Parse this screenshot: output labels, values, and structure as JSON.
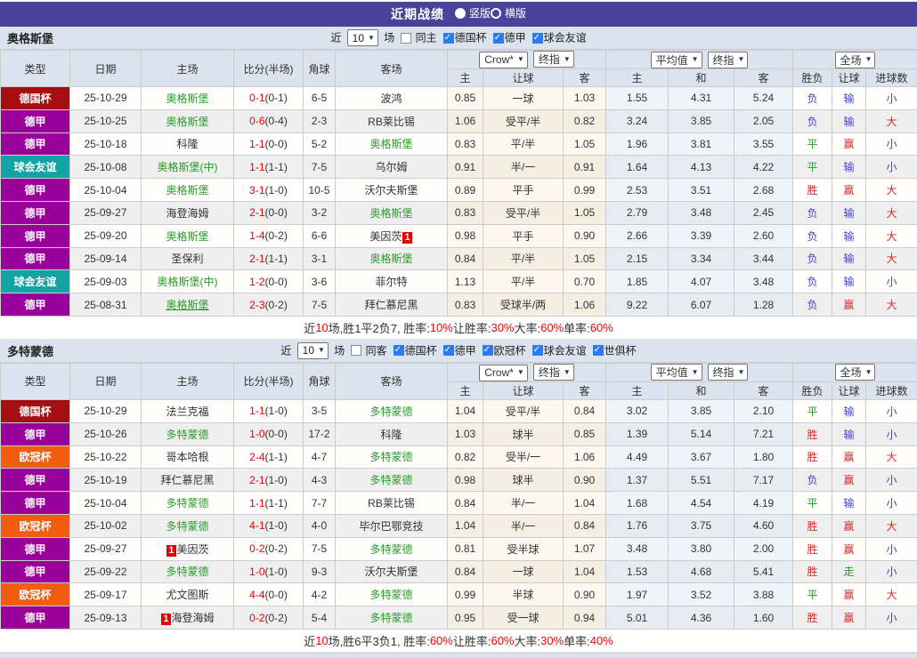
{
  "titlebar": {
    "title": "近期战绩",
    "radios": [
      {
        "label": "竖版",
        "selected": true
      },
      {
        "label": "横版",
        "selected": false
      }
    ]
  },
  "table_header": {
    "main_cols": [
      "类型",
      "日期",
      "主场",
      "比分(半场)",
      "角球",
      "客场"
    ],
    "groups": [
      {
        "selects": [
          "Crow*",
          "终指"
        ],
        "subs": [
          "主",
          "让球",
          "客"
        ]
      },
      {
        "selects": [
          "平均值",
          "终指"
        ],
        "subs": [
          "主",
          "和",
          "客"
        ]
      },
      {
        "selects": [
          "全场"
        ],
        "subs": [
          "胜负",
          "让球",
          "进球数"
        ]
      }
    ]
  },
  "type_colors": {
    "德国杯": "#a50e13",
    "德甲": "#990099",
    "球会友谊": "#13a3a3",
    "欧冠杯": "#f25c0f"
  },
  "colors": {
    "titlebar_bg": "#4b439b",
    "header_bg": "#dbe3ee",
    "team_green": "#2b9b2b",
    "score_red": "#e80000",
    "result_red": "#cf2d2d",
    "result_blue": "#4141cc",
    "result_green": "#2a9b2a",
    "summary_red": "#ff0000"
  },
  "sections": [
    {
      "team": "奥格斯堡",
      "filter": {
        "prefix": "近",
        "count": "10",
        "suffix": "场",
        "same": {
          "label": "同主",
          "checked": false
        },
        "leagues": [
          {
            "label": "德国杯",
            "checked": true
          },
          {
            "label": "德甲",
            "checked": true
          },
          {
            "label": "球会友谊",
            "checked": true
          }
        ]
      },
      "rows": [
        {
          "type": "德国杯",
          "date": "25-10-29",
          "home": {
            "name": "奥格斯堡",
            "green": true
          },
          "score": "0-1",
          "half": "(0-1)",
          "corner": "6-5",
          "away": {
            "name": "波鸿"
          },
          "odds": [
            "0.85",
            "一球",
            "1.03"
          ],
          "avg": [
            "1.55",
            "4.31",
            "5.24"
          ],
          "results": [
            [
              "负",
              "blue"
            ],
            [
              "输",
              "blue"
            ],
            [
              "小",
              "blue"
            ]
          ]
        },
        {
          "type": "德甲",
          "date": "25-10-25",
          "home": {
            "name": "奥格斯堡",
            "green": true
          },
          "score": "0-6",
          "half": "(0-4)",
          "corner": "2-3",
          "away": {
            "name": "RB莱比锡"
          },
          "odds": [
            "1.06",
            "受平/半",
            "0.82"
          ],
          "avg": [
            "3.24",
            "3.85",
            "2.05"
          ],
          "results": [
            [
              "负",
              "blue"
            ],
            [
              "输",
              "blue"
            ],
            [
              "大",
              "red"
            ]
          ]
        },
        {
          "type": "德甲",
          "date": "25-10-18",
          "home": {
            "name": "科隆"
          },
          "score": "1-1",
          "half": "(0-0)",
          "corner": "5-2",
          "away": {
            "name": "奥格斯堡",
            "green": true
          },
          "odds": [
            "0.83",
            "平/半",
            "1.05"
          ],
          "avg": [
            "1.96",
            "3.81",
            "3.55"
          ],
          "results": [
            [
              "平",
              "green"
            ],
            [
              "赢",
              "red"
            ],
            [
              "小",
              "blue"
            ]
          ]
        },
        {
          "type": "球会友谊",
          "date": "25-10-08",
          "home": {
            "name": "奥格斯堡(中)",
            "green": true
          },
          "score": "1-1",
          "half": "(1-1)",
          "corner": "7-5",
          "away": {
            "name": "乌尔姆"
          },
          "odds": [
            "0.91",
            "半/一",
            "0.91"
          ],
          "avg": [
            "1.64",
            "4.13",
            "4.22"
          ],
          "results": [
            [
              "平",
              "green"
            ],
            [
              "输",
              "blue"
            ],
            [
              "小",
              "blue"
            ]
          ]
        },
        {
          "type": "德甲",
          "date": "25-10-04",
          "home": {
            "name": "奥格斯堡",
            "green": true
          },
          "score": "3-1",
          "half": "(1-0)",
          "corner": "10-5",
          "away": {
            "name": "沃尔夫斯堡"
          },
          "odds": [
            "0.89",
            "平手",
            "0.99"
          ],
          "avg": [
            "2.53",
            "3.51",
            "2.68"
          ],
          "results": [
            [
              "胜",
              "red"
            ],
            [
              "赢",
              "red"
            ],
            [
              "大",
              "red"
            ]
          ]
        },
        {
          "type": "德甲",
          "date": "25-09-27",
          "home": {
            "name": "海登海姆"
          },
          "score": "2-1",
          "half": "(0-0)",
          "corner": "3-2",
          "away": {
            "name": "奥格斯堡",
            "green": true
          },
          "odds": [
            "0.83",
            "受平/半",
            "1.05"
          ],
          "avg": [
            "2.79",
            "3.48",
            "2.45"
          ],
          "results": [
            [
              "负",
              "blue"
            ],
            [
              "输",
              "blue"
            ],
            [
              "大",
              "red"
            ]
          ]
        },
        {
          "type": "德甲",
          "date": "25-09-20",
          "home": {
            "name": "奥格斯堡",
            "green": true
          },
          "score": "1-4",
          "half": "(0-2)",
          "corner": "6-6",
          "away": {
            "name": "美因茨",
            "redcard": "after"
          },
          "odds": [
            "0.98",
            "平手",
            "0.90"
          ],
          "avg": [
            "2.66",
            "3.39",
            "2.60"
          ],
          "results": [
            [
              "负",
              "blue"
            ],
            [
              "输",
              "blue"
            ],
            [
              "大",
              "red"
            ]
          ]
        },
        {
          "type": "德甲",
          "date": "25-09-14",
          "home": {
            "name": "圣保利"
          },
          "score": "2-1",
          "half": "(1-1)",
          "corner": "3-1",
          "away": {
            "name": "奥格斯堡",
            "green": true
          },
          "odds": [
            "0.84",
            "平/半",
            "1.05"
          ],
          "avg": [
            "2.15",
            "3.34",
            "3.44"
          ],
          "results": [
            [
              "负",
              "blue"
            ],
            [
              "输",
              "blue"
            ],
            [
              "大",
              "red"
            ]
          ]
        },
        {
          "type": "球会友谊",
          "date": "25-09-03",
          "home": {
            "name": "奥格斯堡(中)",
            "green": true
          },
          "score": "1-2",
          "half": "(0-0)",
          "corner": "3-6",
          "away": {
            "name": "菲尔特"
          },
          "odds": [
            "1.13",
            "平/半",
            "0.70"
          ],
          "avg": [
            "1.85",
            "4.07",
            "3.48"
          ],
          "results": [
            [
              "负",
              "blue"
            ],
            [
              "输",
              "blue"
            ],
            [
              "小",
              "blue"
            ]
          ]
        },
        {
          "type": "德甲",
          "date": "25-08-31",
          "home": {
            "name": "奥格斯堡",
            "green": true,
            "underline": true
          },
          "score": "2-3",
          "half": "(0-2)",
          "corner": "7-5",
          "away": {
            "name": "拜仁慕尼黑"
          },
          "odds": [
            "0.83",
            "受球半/两",
            "1.06"
          ],
          "avg": [
            "9.22",
            "6.07",
            "1.28"
          ],
          "results": [
            [
              "负",
              "blue"
            ],
            [
              "赢",
              "red"
            ],
            [
              "大",
              "red"
            ]
          ]
        }
      ],
      "summary": [
        [
          "近",
          false
        ],
        [
          "10",
          true
        ],
        [
          "场,胜1平2负7, 胜率:",
          false
        ],
        [
          "10%",
          true
        ],
        [
          " 让胜率:",
          false
        ],
        [
          "30%",
          true
        ],
        [
          " 大率:",
          false
        ],
        [
          "60%",
          true
        ],
        [
          " 单率:",
          false
        ],
        [
          "60%",
          true
        ]
      ]
    },
    {
      "team": "多特蒙德",
      "filter": {
        "prefix": "近",
        "count": "10",
        "suffix": "场",
        "same": {
          "label": "同客",
          "checked": false
        },
        "leagues": [
          {
            "label": "德国杯",
            "checked": true
          },
          {
            "label": "德甲",
            "checked": true
          },
          {
            "label": "欧冠杯",
            "checked": true
          },
          {
            "label": "球会友谊",
            "checked": true
          },
          {
            "label": "世俱杯",
            "checked": true
          }
        ]
      },
      "rows": [
        {
          "type": "德国杯",
          "date": "25-10-29",
          "home": {
            "name": "法兰克福"
          },
          "score": "1-1",
          "half": "(1-0)",
          "corner": "3-5",
          "away": {
            "name": "多特蒙德",
            "green": true
          },
          "odds": [
            "1.04",
            "受平/半",
            "0.84"
          ],
          "avg": [
            "3.02",
            "3.85",
            "2.10"
          ],
          "results": [
            [
              "平",
              "green"
            ],
            [
              "输",
              "blue"
            ],
            [
              "小",
              "blue"
            ]
          ]
        },
        {
          "type": "德甲",
          "date": "25-10-26",
          "home": {
            "name": "多特蒙德",
            "green": true
          },
          "score": "1-0",
          "half": "(0-0)",
          "corner": "17-2",
          "away": {
            "name": "科隆"
          },
          "odds": [
            "1.03",
            "球半",
            "0.85"
          ],
          "avg": [
            "1.39",
            "5.14",
            "7.21"
          ],
          "results": [
            [
              "胜",
              "red"
            ],
            [
              "输",
              "blue"
            ],
            [
              "小",
              "blue"
            ]
          ]
        },
        {
          "type": "欧冠杯",
          "date": "25-10-22",
          "home": {
            "name": "哥本哈根"
          },
          "score": "2-4",
          "half": "(1-1)",
          "corner": "4-7",
          "away": {
            "name": "多特蒙德",
            "green": true
          },
          "odds": [
            "0.82",
            "受半/一",
            "1.06"
          ],
          "avg": [
            "4.49",
            "3.67",
            "1.80"
          ],
          "results": [
            [
              "胜",
              "red"
            ],
            [
              "赢",
              "red"
            ],
            [
              "大",
              "red"
            ]
          ]
        },
        {
          "type": "德甲",
          "date": "25-10-19",
          "home": {
            "name": "拜仁慕尼黑"
          },
          "score": "2-1",
          "half": "(1-0)",
          "corner": "4-3",
          "away": {
            "name": "多特蒙德",
            "green": true
          },
          "odds": [
            "0.98",
            "球半",
            "0.90"
          ],
          "avg": [
            "1.37",
            "5.51",
            "7.17"
          ],
          "results": [
            [
              "负",
              "blue"
            ],
            [
              "赢",
              "red"
            ],
            [
              "小",
              "blue"
            ]
          ]
        },
        {
          "type": "德甲",
          "date": "25-10-04",
          "home": {
            "name": "多特蒙德",
            "green": true
          },
          "score": "1-1",
          "half": "(1-1)",
          "corner": "7-7",
          "away": {
            "name": "RB莱比锡"
          },
          "odds": [
            "0.84",
            "半/一",
            "1.04"
          ],
          "avg": [
            "1.68",
            "4.54",
            "4.19"
          ],
          "results": [
            [
              "平",
              "green"
            ],
            [
              "输",
              "blue"
            ],
            [
              "小",
              "blue"
            ]
          ]
        },
        {
          "type": "欧冠杯",
          "date": "25-10-02",
          "home": {
            "name": "多特蒙德",
            "green": true
          },
          "score": "4-1",
          "half": "(1-0)",
          "corner": "4-0",
          "away": {
            "name": "毕尔巴鄂竞技"
          },
          "odds": [
            "1.04",
            "半/一",
            "0.84"
          ],
          "avg": [
            "1.76",
            "3.75",
            "4.60"
          ],
          "results": [
            [
              "胜",
              "red"
            ],
            [
              "赢",
              "red"
            ],
            [
              "大",
              "red"
            ]
          ]
        },
        {
          "type": "德甲",
          "date": "25-09-27",
          "home": {
            "name": "美因茨",
            "redcard": "before"
          },
          "score": "0-2",
          "half": "(0-2)",
          "corner": "7-5",
          "away": {
            "name": "多特蒙德",
            "green": true
          },
          "odds": [
            "0.81",
            "受半球",
            "1.07"
          ],
          "avg": [
            "3.48",
            "3.80",
            "2.00"
          ],
          "results": [
            [
              "胜",
              "red"
            ],
            [
              "赢",
              "red"
            ],
            [
              "小",
              "blue"
            ]
          ]
        },
        {
          "type": "德甲",
          "date": "25-09-22",
          "home": {
            "name": "多特蒙德",
            "green": true
          },
          "score": "1-0",
          "half": "(1-0)",
          "corner": "9-3",
          "away": {
            "name": "沃尔夫斯堡"
          },
          "odds": [
            "0.84",
            "一球",
            "1.04"
          ],
          "avg": [
            "1.53",
            "4.68",
            "5.41"
          ],
          "results": [
            [
              "胜",
              "red"
            ],
            [
              "走",
              "green"
            ],
            [
              "小",
              "blue"
            ]
          ]
        },
        {
          "type": "欧冠杯",
          "date": "25-09-17",
          "home": {
            "name": "尤文图斯"
          },
          "score": "4-4",
          "half": "(0-0)",
          "corner": "4-2",
          "away": {
            "name": "多特蒙德",
            "green": true
          },
          "odds": [
            "0.99",
            "半球",
            "0.90"
          ],
          "avg": [
            "1.97",
            "3.52",
            "3.88"
          ],
          "results": [
            [
              "平",
              "green"
            ],
            [
              "赢",
              "red"
            ],
            [
              "大",
              "red"
            ]
          ]
        },
        {
          "type": "德甲",
          "date": "25-09-13",
          "home": {
            "name": "海登海姆",
            "redcard": "before"
          },
          "score": "0-2",
          "half": "(0-2)",
          "corner": "5-4",
          "away": {
            "name": "多特蒙德",
            "green": true
          },
          "odds": [
            "0.95",
            "受一球",
            "0.94"
          ],
          "avg": [
            "5.01",
            "4.36",
            "1.60"
          ],
          "results": [
            [
              "胜",
              "red"
            ],
            [
              "赢",
              "red"
            ],
            [
              "小",
              "blue"
            ]
          ]
        }
      ],
      "summary": [
        [
          "近",
          false
        ],
        [
          "10",
          true
        ],
        [
          "场,胜6平3负1, 胜率:",
          false
        ],
        [
          "60%",
          true
        ],
        [
          " 让胜率:",
          false
        ],
        [
          "60%",
          true
        ],
        [
          " 大率:",
          false
        ],
        [
          "30%",
          true
        ],
        [
          " 单率:",
          false
        ],
        [
          "40%",
          true
        ]
      ]
    }
  ]
}
